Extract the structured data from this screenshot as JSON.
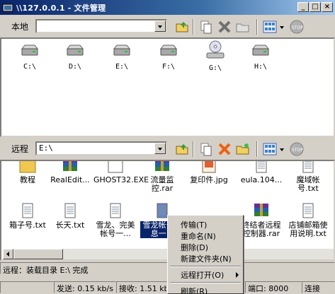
{
  "window": {
    "title": "\\\\127.0.0.1 - 文件管理",
    "min": "_",
    "max": "□",
    "close": "×"
  },
  "local": {
    "label": "本地",
    "path": "",
    "drives": [
      "C:\\",
      "D:\\",
      "E:\\",
      "F:\\",
      "G:\\",
      "H:\\"
    ]
  },
  "remote": {
    "label": "远程",
    "path": "E:\\"
  },
  "files_row1": [
    "教程",
    "RealEdit...",
    "GHOST32.EXE",
    "流量监控.rar",
    "复印件.jpg",
    "eula.104...",
    "魔域帐号.txt"
  ],
  "files_row2": [
    "箱子号.txt",
    "长天.txt",
    "雪龙、完美帐号一...",
    "雪龙帐号一息一...",
    "",
    "终结者远程控制器.rar",
    "店铺邮箱使用说明.txt"
  ],
  "status": {
    "remote_line": "远程：装载目录 E:\\ 完成",
    "send": "发送: 0.15 kb/s",
    "recv": "接收: 1.51 kb",
    "port": "端口: 8000",
    "conn": "连接"
  },
  "context_menu": {
    "transfer": "传输(T)",
    "rename": "重命名(N)",
    "delete": "删除(D)",
    "new_folder": "新建文件夹(N)",
    "remote_open": "远程打开(O)",
    "refresh": "刷新(R)"
  },
  "colors": {
    "title_start": "#0a246a",
    "title_end": "#a6caf0",
    "winrar": "#8b1a6b"
  }
}
